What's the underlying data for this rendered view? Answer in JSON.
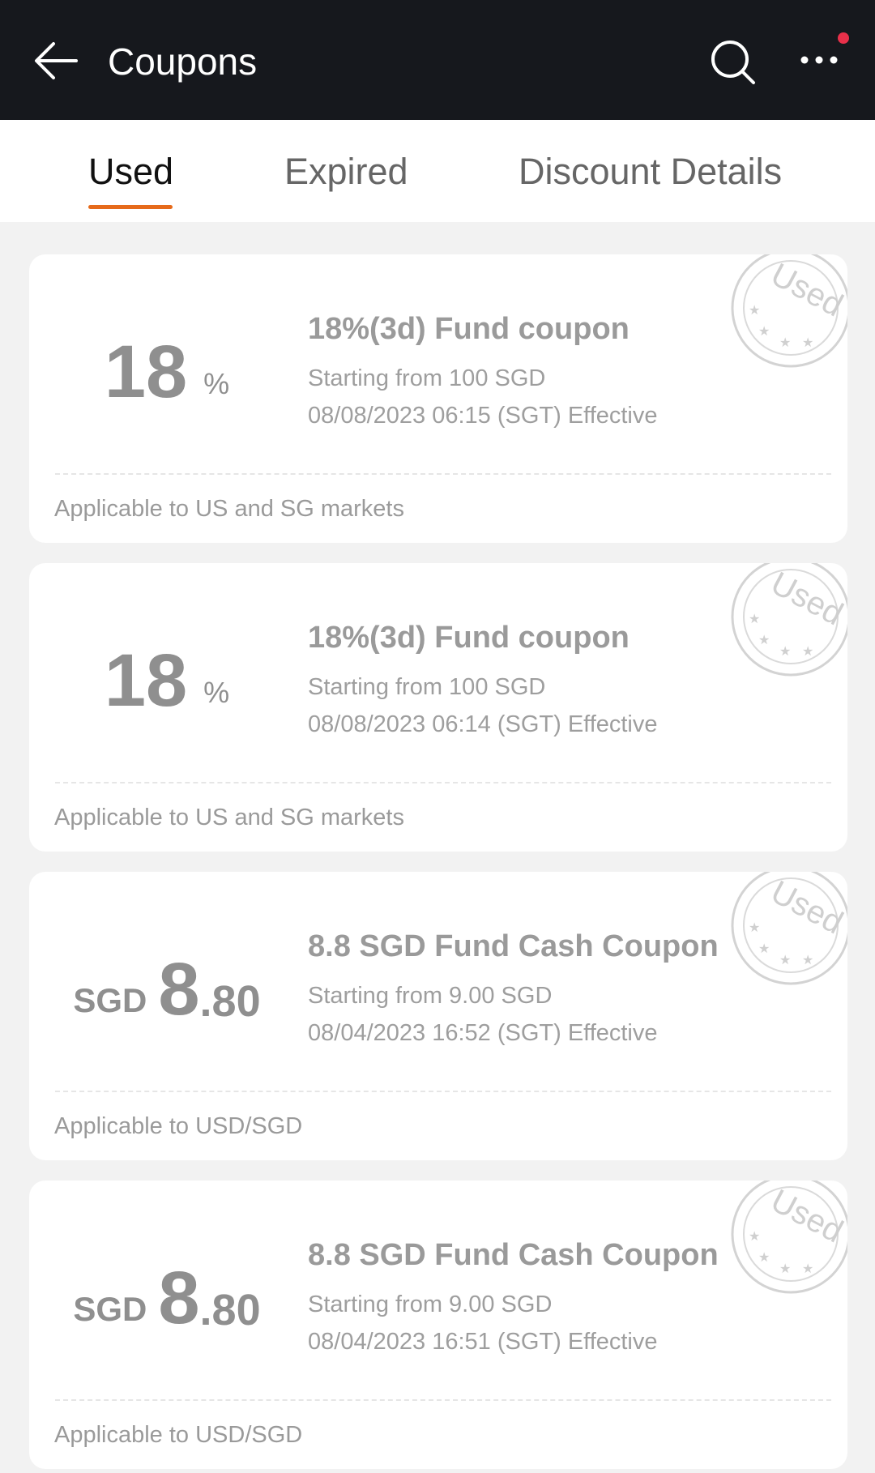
{
  "header": {
    "title": "Coupons"
  },
  "tabs": [
    {
      "label": "Used",
      "active": true
    },
    {
      "label": "Expired",
      "active": false
    },
    {
      "label": "Discount Details",
      "active": false
    }
  ],
  "colors": {
    "accent": "#e66a1a",
    "header_bg": "#16181d",
    "notification_dot": "#e8304a"
  },
  "icons": {
    "back": "arrow-left-icon",
    "search": "search-icon",
    "more": "more-horizontal-icon",
    "stamp": "used-stamp-icon"
  },
  "coupons": [
    {
      "value_main": "18",
      "value_unit": "%",
      "name": "18%(3d) Fund coupon",
      "min_spend": "Starting from 100 SGD",
      "effective": "08/08/2023 06:15 (SGT) Effective",
      "scope": "Applicable to US and SG markets",
      "stamp": "Used"
    },
    {
      "value_main": "18",
      "value_unit": "%",
      "name": "18%(3d) Fund coupon",
      "min_spend": "Starting from 100 SGD",
      "effective": "08/08/2023 06:14 (SGT) Effective",
      "scope": "Applicable to US and SG markets",
      "stamp": "Used"
    },
    {
      "currency": "SGD",
      "value_main": "8",
      "value_decimal": ".80",
      "name": "8.8 SGD Fund Cash Coupon",
      "min_spend": "Starting from 9.00 SGD",
      "effective": "08/04/2023 16:52 (SGT) Effective",
      "scope": "Applicable to USD/SGD",
      "stamp": "Used"
    },
    {
      "currency": "SGD",
      "value_main": "8",
      "value_decimal": ".80",
      "name": "8.8 SGD Fund Cash Coupon",
      "min_spend": "Starting from 9.00 SGD",
      "effective": "08/04/2023 16:51 (SGT) Effective",
      "scope": "Applicable to USD/SGD",
      "stamp": "Used"
    }
  ]
}
